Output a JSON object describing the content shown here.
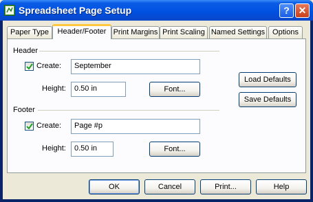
{
  "window": {
    "title": "Spreadsheet Page Setup",
    "help_glyph": "?",
    "close_glyph": "✕",
    "icon": "spreadsheet-app-icon"
  },
  "tabs": [
    {
      "label": "Paper Type"
    },
    {
      "label": "Header/Footer"
    },
    {
      "label": "Print Margins"
    },
    {
      "label": "Print Scaling"
    },
    {
      "label": "Named Settings"
    },
    {
      "label": "Options"
    }
  ],
  "header": {
    "group_label": "Header",
    "create_label": "Create:",
    "create_checked": true,
    "text_value": "September",
    "height_label": "Height:",
    "height_value": "0.50 in",
    "font_button": "Font..."
  },
  "footer": {
    "group_label": "Footer",
    "create_label": "Create:",
    "create_checked": true,
    "text_value": "Page #p",
    "height_label": "Height:",
    "height_value": "0.50 in",
    "font_button": "Font..."
  },
  "side_buttons": {
    "load_defaults": "Load Defaults",
    "save_defaults": "Save Defaults"
  },
  "bottom_buttons": {
    "ok": "OK",
    "cancel": "Cancel",
    "print": "Print...",
    "help": "Help"
  }
}
